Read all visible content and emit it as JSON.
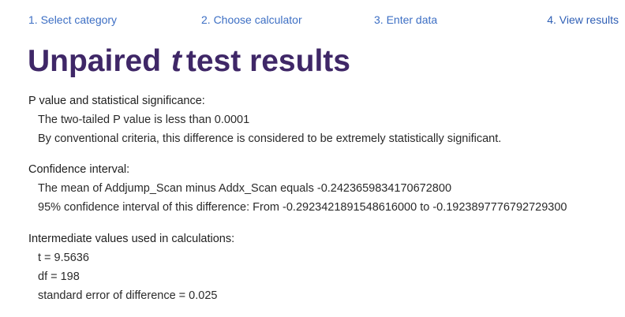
{
  "steps": [
    {
      "label": "1. Select category"
    },
    {
      "label": "2. Choose calculator"
    },
    {
      "label": "3. Enter data"
    },
    {
      "label": "4. View results"
    }
  ],
  "title": {
    "prefix": "Unpaired",
    "variable": "t",
    "suffix": "test results"
  },
  "sections": {
    "significance": {
      "heading": "P value and statistical significance:",
      "lines": [
        "The two-tailed P value is less than 0.0001",
        "By conventional criteria, this difference is considered to be extremely statistically significant."
      ]
    },
    "confidence": {
      "heading": "Confidence interval:",
      "lines": [
        "The mean of Addjump_Scan minus Addx_Scan equals -0.2423659834170672800",
        "95% confidence interval of this difference: From -0.2923421891548616000 to -0.1923897776792729300"
      ]
    },
    "intermediate": {
      "heading": "Intermediate values used in calculations:",
      "lines": [
        "t = 9.5636",
        "df = 198",
        "standard error of difference = 0.025"
      ]
    }
  },
  "colors": {
    "step_link": "#3d6fc4",
    "title": "#3f2767",
    "text": "#1e1e1e"
  }
}
